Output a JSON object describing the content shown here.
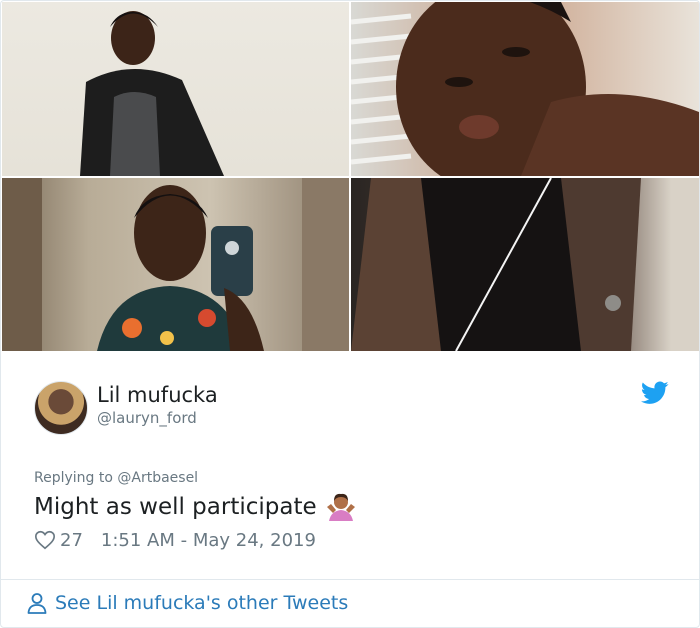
{
  "photos": [
    {
      "alt_icon": "photo-icon"
    },
    {
      "alt_icon": "photo-icon"
    },
    {
      "alt_icon": "photo-icon"
    },
    {
      "alt_icon": "photo-icon"
    }
  ],
  "tweet": {
    "display_name": "Lil mufucka",
    "handle": "@lauryn_ford",
    "replying_to": "Replying to @Artbaesel",
    "text": "Might as well participate",
    "emoji": "person-shrugging-emoji",
    "likes": "27",
    "timestamp": "1:51 AM - May 24, 2019"
  },
  "footer": {
    "see_more": "See Lil mufucka's other Tweets"
  },
  "colors": {
    "twitter_blue": "#1da1f2",
    "link_blue": "#2b7bb9",
    "text_primary": "#1c2022",
    "text_secondary": "#697882",
    "border": "#e1e8ed"
  }
}
